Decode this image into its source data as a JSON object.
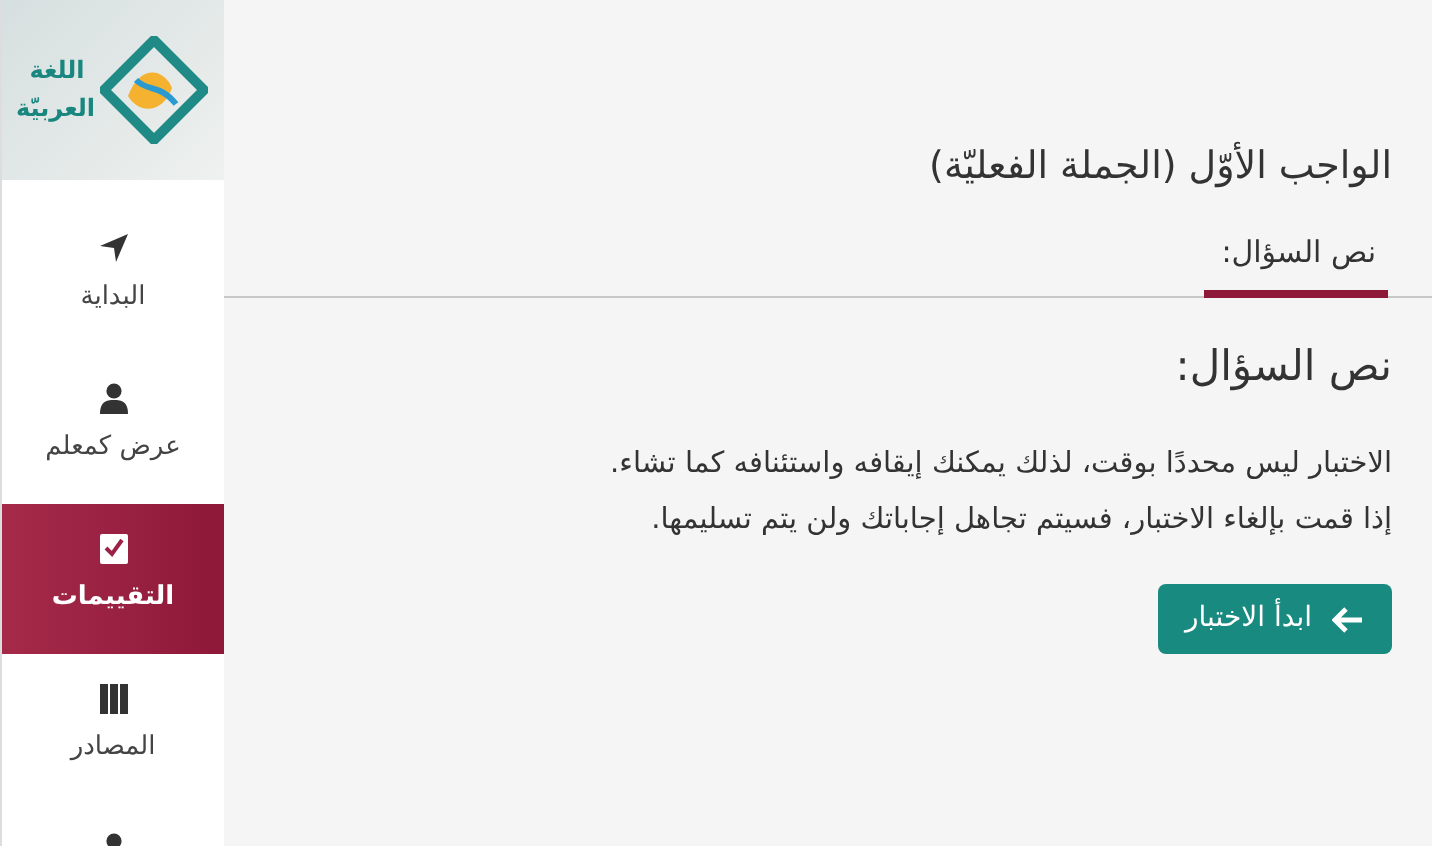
{
  "logo": {
    "text": "اللغة العربيّة"
  },
  "sidebar": {
    "items": [
      {
        "kind": "arrow",
        "label": "البداية",
        "selected": false
      },
      {
        "kind": "person",
        "label": "عرض كمعلم",
        "selected": false
      },
      {
        "kind": "check",
        "label": "التقييمات",
        "selected": true
      },
      {
        "kind": "books",
        "label": "المصادر",
        "selected": false
      },
      {
        "kind": "person",
        "selected": false
      }
    ]
  },
  "page": {
    "title": "الواجب الأوّل (الجملة الفعليّة)",
    "tabs": [
      {
        "label": "نص السؤال:",
        "selected": true
      }
    ],
    "heading": "نص السؤال:",
    "paragraphs": [
      "الاختبار ليس محددًا بوقت، لذلك يمكنك إيقافه واستئنافه كما تشاء.",
      "إذا قمت بإلغاء الاختبار، فسيتم تجاهل إجاباتك ولن يتم تسليمها."
    ],
    "button": "ابدأ الاختبار"
  }
}
